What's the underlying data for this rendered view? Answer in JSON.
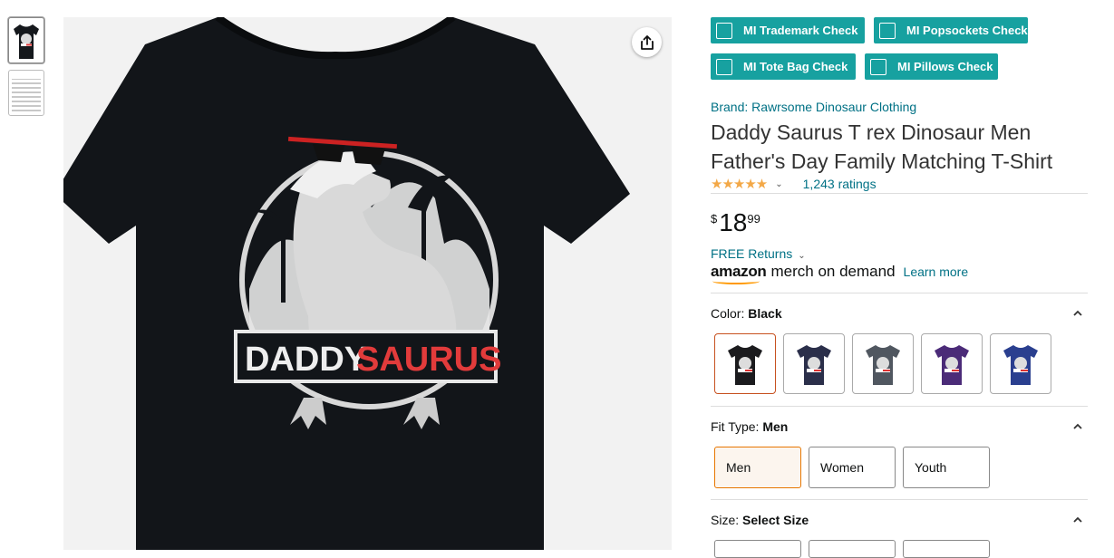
{
  "gallery": {
    "thumbnails": [
      "tshirt-front-thumbnail",
      "size-chart-thumbnail"
    ]
  },
  "main_image": {
    "shirt_color": "#121519",
    "print_text_left": "DADDY",
    "print_text_right": "SAURUS",
    "share_icon": "share-icon"
  },
  "mi_checks": [
    {
      "label": "MI Trademark Check"
    },
    {
      "label": "MI Popsockets Check"
    },
    {
      "label": "MI Tote Bag Check"
    },
    {
      "label": "MI Pillows Check"
    }
  ],
  "product": {
    "brand": "Brand: Rawrsome Dinosaur Clothing",
    "title": "Daddy Saurus T rex Dinosaur Men Father's Day Family Matching T-Shirt",
    "rating_stars": "★★★★★",
    "ratings_count": "1,243 ratings",
    "price": {
      "symbol": "$",
      "whole": "18",
      "fraction": "99"
    },
    "returns": "FREE Returns",
    "merch_logo_amazon": "amazon",
    "merch_logo_text": "merch on demand",
    "learn_more": "Learn more"
  },
  "color": {
    "label": "Color:",
    "selected": "Black",
    "swatches": [
      {
        "name": "Black",
        "hex": "#1b1b1e"
      },
      {
        "name": "Navy",
        "hex": "#2b2f4a"
      },
      {
        "name": "Heather Grey",
        "hex": "#505760"
      },
      {
        "name": "Purple",
        "hex": "#4b2b78"
      },
      {
        "name": "Royal Blue",
        "hex": "#2a3f8f"
      }
    ]
  },
  "fit": {
    "label": "Fit Type:",
    "selected": "Men",
    "options": [
      "Men",
      "Women",
      "Youth"
    ]
  },
  "size": {
    "label": "Size:",
    "selected": "Select Size"
  },
  "colors": {
    "teal": "#17a1a0",
    "link": "#007185",
    "star": "#f3a847",
    "selected_border": "#e77600"
  }
}
